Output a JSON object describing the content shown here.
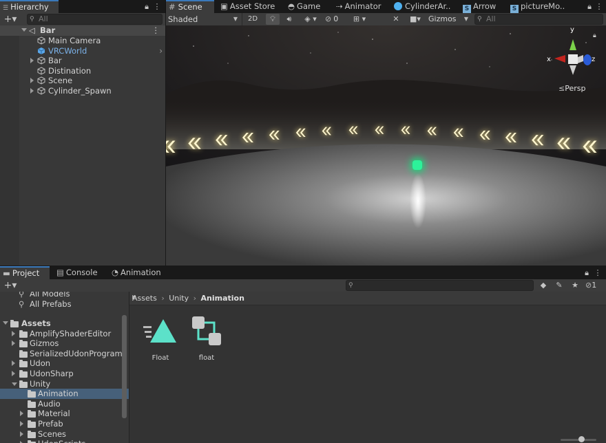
{
  "hierarchy": {
    "tab_label": "Hierarchy",
    "search_placeholder": "All",
    "scene_root": "Bar",
    "items": [
      "Main Camera",
      "VRCWorld",
      "Bar",
      "Distination",
      "Scene",
      "Cylinder_Spawn"
    ]
  },
  "scene_tabs": {
    "tabs": [
      "Scene",
      "Asset Store",
      "Game",
      "Animator",
      "CylinderAr..",
      "Arrow",
      "pictureMo.."
    ],
    "shading_mode": "Shaded",
    "mode_2d": "2D",
    "hidden_count": "0",
    "gizmos_label": "Gizmos",
    "search_placeholder": "All"
  },
  "scene_view": {
    "axis_labels": {
      "y": "y",
      "x": "x",
      "z": "z"
    },
    "projection_label": "Persp"
  },
  "bottom_tabs": [
    "Project",
    "Console",
    "Animation"
  ],
  "project": {
    "hidden_count": "1",
    "favorites": [
      "All Models",
      "All Prefabs"
    ],
    "assets_root": "Assets",
    "folders": [
      {
        "name": "AmplifyShaderEditor",
        "depth": 1,
        "arrow": "right"
      },
      {
        "name": "Gizmos",
        "depth": 1,
        "arrow": "right"
      },
      {
        "name": "SerializedUdonPrograms",
        "depth": 1,
        "arrow": "none"
      },
      {
        "name": "Udon",
        "depth": 1,
        "arrow": "right"
      },
      {
        "name": "UdonSharp",
        "depth": 1,
        "arrow": "right"
      },
      {
        "name": "Unity",
        "depth": 1,
        "arrow": "down"
      },
      {
        "name": "Animation",
        "depth": 2,
        "arrow": "none",
        "selected": true
      },
      {
        "name": "Audio",
        "depth": 2,
        "arrow": "none"
      },
      {
        "name": "Material",
        "depth": 2,
        "arrow": "right"
      },
      {
        "name": "Prefab",
        "depth": 2,
        "arrow": "right"
      },
      {
        "name": "Scenes",
        "depth": 2,
        "arrow": "right"
      },
      {
        "name": "UdonScripts",
        "depth": 2,
        "arrow": "right"
      }
    ],
    "breadcrumb": [
      "Assets",
      "Unity",
      "Animation"
    ],
    "assets": [
      {
        "name": "Float",
        "icon": "animation-clip-icon"
      },
      {
        "name": "float",
        "icon": "animator-controller-icon"
      }
    ]
  },
  "colors": {
    "selection": "#2c5d87",
    "accent_blue": "#3a79bb",
    "prefab_blue": "#7cb3ea",
    "arrow_yellow": "#ffe98a"
  }
}
